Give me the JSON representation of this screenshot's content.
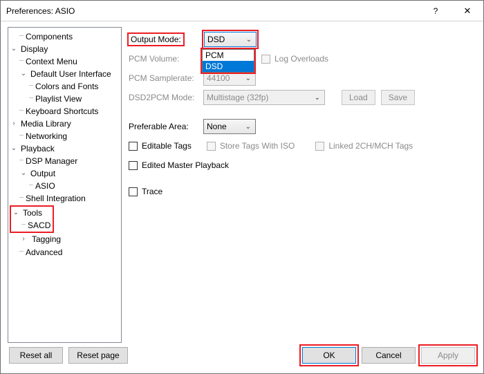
{
  "window": {
    "title": "Preferences: ASIO"
  },
  "titlebar": {
    "help": "?",
    "close": "✕"
  },
  "tree": {
    "components": "Components",
    "display": "Display",
    "context_menu": "Context Menu",
    "dui": "Default User Interface",
    "colors_fonts": "Colors and Fonts",
    "playlist_view": "Playlist View",
    "kb_shortcuts": "Keyboard Shortcuts",
    "media_library": "Media Library",
    "networking": "Networking",
    "playback": "Playback",
    "dsp_manager": "DSP Manager",
    "output": "Output",
    "asio": "ASIO",
    "shell_integration": "Shell Integration",
    "tools": "Tools",
    "sacd": "SACD",
    "tagging": "Tagging",
    "advanced": "Advanced"
  },
  "form": {
    "output_mode": {
      "label": "Output Mode:",
      "value": "DSD",
      "options": [
        "PCM",
        "DSD"
      ]
    },
    "pcm_volume": {
      "label": "PCM Volume:",
      "value": "",
      "log_overloads": "Log Overloads"
    },
    "pcm_samplerate": {
      "label": "PCM Samplerate:",
      "value": "44100"
    },
    "dsd2pcm": {
      "label": "DSD2PCM Mode:",
      "value": "Multistage (32fp)",
      "load": "Load",
      "save": "Save"
    },
    "pref_area": {
      "label": "Preferable Area:",
      "value": "None"
    },
    "editable_tags": "Editable Tags",
    "store_tags_iso": "Store Tags With ISO",
    "linked_tags": "Linked 2CH/MCH Tags",
    "edited_master": "Edited Master Playback",
    "trace": "Trace"
  },
  "footer": {
    "reset_all": "Reset all",
    "reset_page": "Reset page",
    "ok": "OK",
    "cancel": "Cancel",
    "apply": "Apply"
  }
}
